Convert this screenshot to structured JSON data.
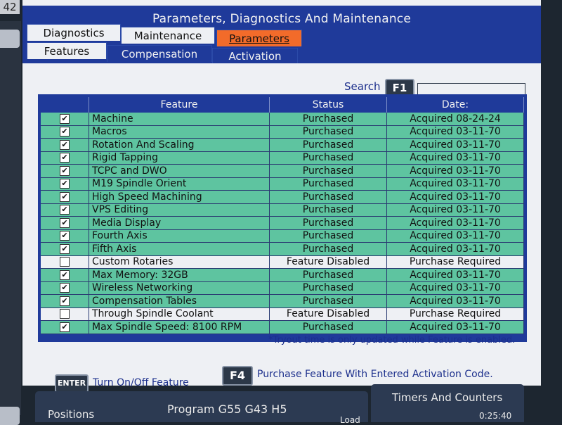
{
  "corner": {
    "number": "42"
  },
  "window": {
    "title": "Parameters, Diagnostics And Maintenance"
  },
  "tabs_top": [
    {
      "label": "Diagnostics"
    },
    {
      "label": "Maintenance"
    },
    {
      "label": "Parameters",
      "active": true
    }
  ],
  "tabs_sub": [
    {
      "label": "Features",
      "active": true
    },
    {
      "label": "Compensation"
    },
    {
      "label": "Activation"
    }
  ],
  "search": {
    "label": "Search",
    "key": "F1",
    "value": ""
  },
  "table": {
    "headers": {
      "feature": "Feature",
      "status": "Status",
      "date": "Date:"
    },
    "rows": [
      {
        "checked": true,
        "feature": "Machine",
        "status": "Purchased",
        "date": "Acquired 08-24-24"
      },
      {
        "checked": true,
        "feature": "Macros",
        "status": "Purchased",
        "date": "Acquired 03-11-70"
      },
      {
        "checked": true,
        "feature": "Rotation And Scaling",
        "status": "Purchased",
        "date": "Acquired 03-11-70"
      },
      {
        "checked": true,
        "feature": "Rigid Tapping",
        "status": "Purchased",
        "date": "Acquired 03-11-70"
      },
      {
        "checked": true,
        "feature": "TCPC and DWO",
        "status": "Purchased",
        "date": "Acquired 03-11-70"
      },
      {
        "checked": true,
        "feature": "M19 Spindle Orient",
        "status": "Purchased",
        "date": "Acquired 03-11-70"
      },
      {
        "checked": true,
        "feature": "High Speed Machining",
        "status": "Purchased",
        "date": "Acquired 03-11-70"
      },
      {
        "checked": true,
        "feature": "VPS Editing",
        "status": "Purchased",
        "date": "Acquired 03-11-70"
      },
      {
        "checked": true,
        "feature": "Media Display",
        "status": "Purchased",
        "date": "Acquired 03-11-70"
      },
      {
        "checked": true,
        "feature": "Fourth Axis",
        "status": "Purchased",
        "date": "Acquired 03-11-70"
      },
      {
        "checked": true,
        "feature": "Fifth Axis",
        "status": "Purchased",
        "date": "Acquired 03-11-70"
      },
      {
        "checked": false,
        "feature": "Custom Rotaries",
        "status": "Feature Disabled",
        "date": "Purchase Required"
      },
      {
        "checked": true,
        "feature": "Max Memory: 32GB",
        "status": "Purchased",
        "date": "Acquired 03-11-70"
      },
      {
        "checked": true,
        "feature": "Wireless Networking",
        "status": "Purchased",
        "date": "Acquired 03-11-70"
      },
      {
        "checked": true,
        "feature": "Compensation Tables",
        "status": "Purchased",
        "date": "Acquired 03-11-70"
      },
      {
        "checked": false,
        "feature": "Through Spindle Coolant",
        "status": "Feature Disabled",
        "date": "Purchase Required"
      },
      {
        "checked": true,
        "feature": "Max Spindle Speed: 8100 RPM",
        "status": "Purchased",
        "date": "Acquired 03-11-70"
      }
    ]
  },
  "note": "*Tryout time is only updated while Feature is enabled.",
  "hints": {
    "enter_key": "ENTER",
    "enter_text": "Turn On/Off Feature",
    "f4_key": "F4",
    "f4_text": "Purchase Feature With Entered Activation Code."
  },
  "bottom": {
    "positions": "Positions",
    "program": "Program G55 G43 H5",
    "timers": "Timers And Counters",
    "load": "Load",
    "timer_value": "0:25:40"
  },
  "colors": {
    "header_blue": "#1f3a9a",
    "row_green": "#5ec4a0",
    "active_tab_orange": "#f26b2a"
  }
}
